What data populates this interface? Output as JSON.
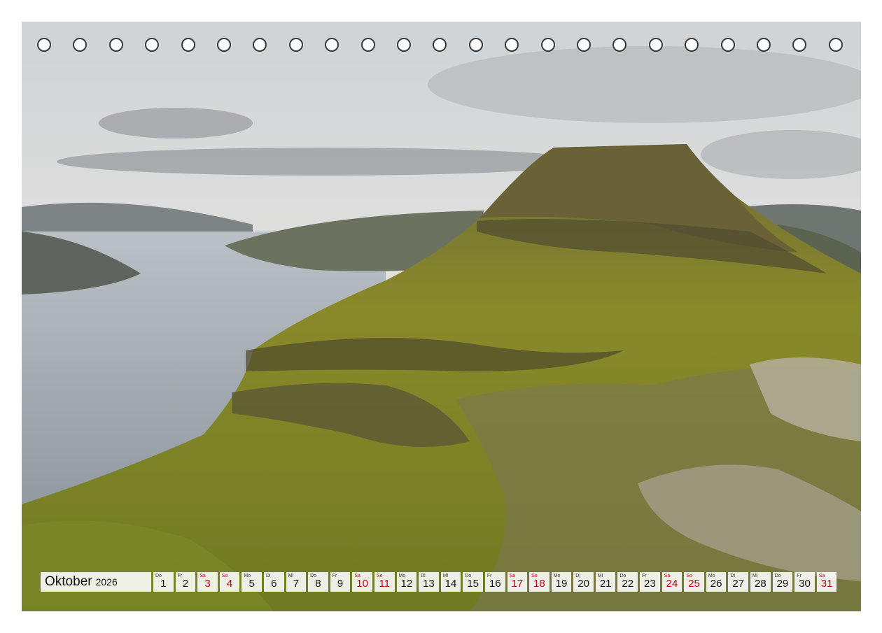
{
  "calendar": {
    "month": "Oktober",
    "year": "2026",
    "days": [
      {
        "dow": "Do",
        "num": "1",
        "weekend": false
      },
      {
        "dow": "Fr",
        "num": "2",
        "weekend": false
      },
      {
        "dow": "Sa",
        "num": "3",
        "weekend": true
      },
      {
        "dow": "So",
        "num": "4",
        "weekend": true
      },
      {
        "dow": "Mo",
        "num": "5",
        "weekend": false
      },
      {
        "dow": "Di",
        "num": "6",
        "weekend": false
      },
      {
        "dow": "Mi",
        "num": "7",
        "weekend": false
      },
      {
        "dow": "Do",
        "num": "8",
        "weekend": false
      },
      {
        "dow": "Fr",
        "num": "9",
        "weekend": false
      },
      {
        "dow": "Sa",
        "num": "10",
        "weekend": true
      },
      {
        "dow": "So",
        "num": "11",
        "weekend": true
      },
      {
        "dow": "Mo",
        "num": "12",
        "weekend": false
      },
      {
        "dow": "Di",
        "num": "13",
        "weekend": false
      },
      {
        "dow": "Mi",
        "num": "14",
        "weekend": false
      },
      {
        "dow": "Do",
        "num": "15",
        "weekend": false
      },
      {
        "dow": "Fr",
        "num": "16",
        "weekend": false
      },
      {
        "dow": "Sa",
        "num": "17",
        "weekend": true
      },
      {
        "dow": "So",
        "num": "18",
        "weekend": true
      },
      {
        "dow": "Mo",
        "num": "19",
        "weekend": false
      },
      {
        "dow": "Di",
        "num": "20",
        "weekend": false
      },
      {
        "dow": "Mi",
        "num": "21",
        "weekend": false
      },
      {
        "dow": "Do",
        "num": "22",
        "weekend": false
      },
      {
        "dow": "Fr",
        "num": "23",
        "weekend": false
      },
      {
        "dow": "Sa",
        "num": "24",
        "weekend": true
      },
      {
        "dow": "So",
        "num": "25",
        "weekend": true
      },
      {
        "dow": "Mo",
        "num": "26",
        "weekend": false
      },
      {
        "dow": "Di",
        "num": "27",
        "weekend": false
      },
      {
        "dow": "Mi",
        "num": "28",
        "weekend": false
      },
      {
        "dow": "Do",
        "num": "29",
        "weekend": false
      },
      {
        "dow": "Fr",
        "num": "30",
        "weekend": false
      },
      {
        "dow": "Sa",
        "num": "31",
        "weekend": true
      }
    ]
  },
  "binding": {
    "ring_count": 23
  },
  "colors": {
    "weekend": "#c0001a",
    "text": "#111111",
    "ring": "#3a3a3a"
  }
}
